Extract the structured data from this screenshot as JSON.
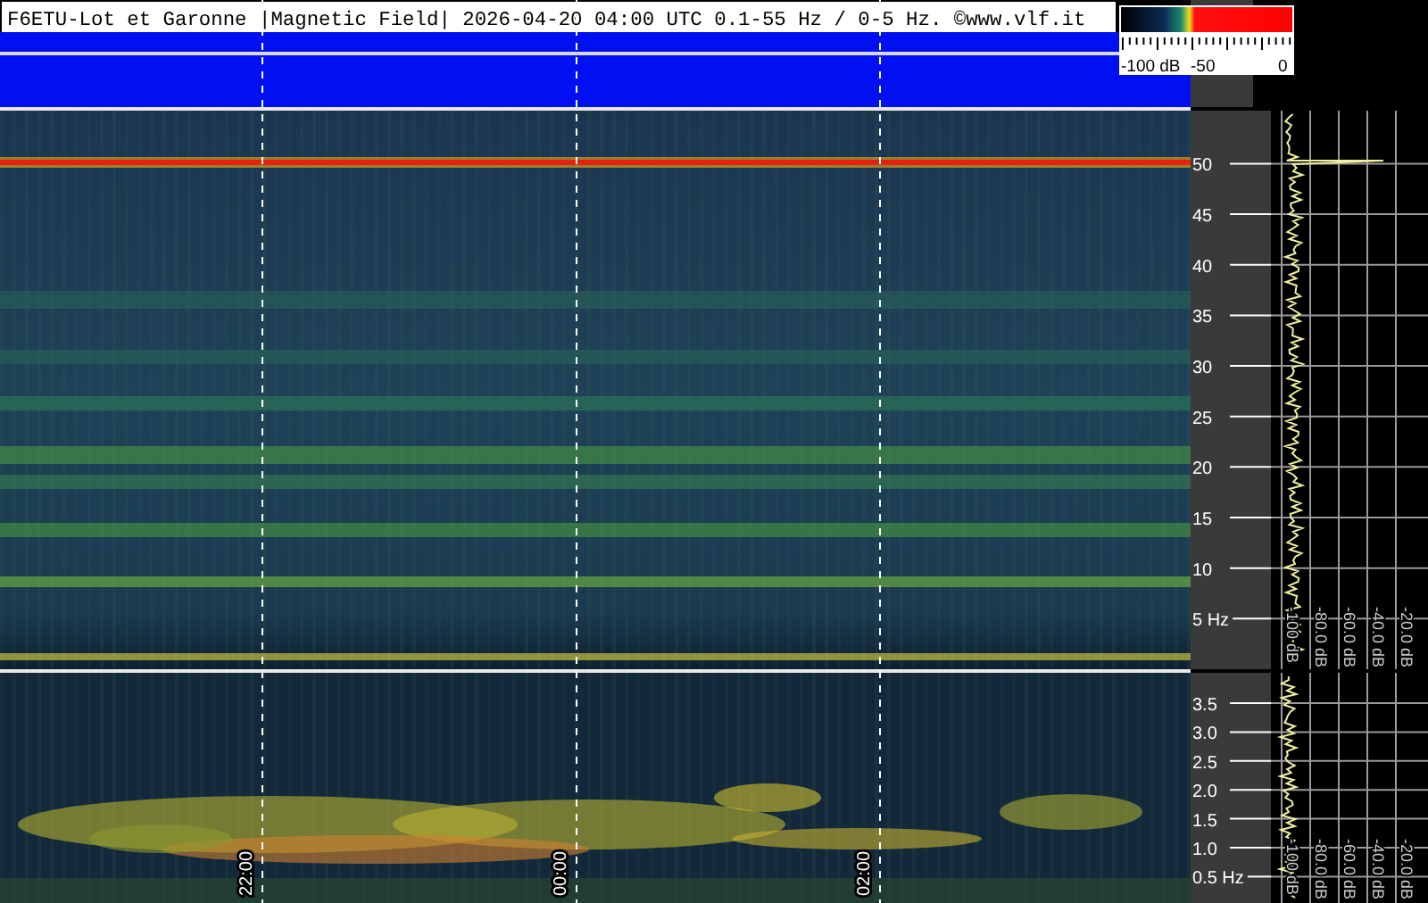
{
  "header": {
    "title": "F6ETU-Lot et Garonne |Magnetic Field| 2026-04-20 04:00 UTC 0.1-55 Hz / 0-5 Hz. ©www.vlf.it"
  },
  "color_scale": {
    "labels": [
      "-100 dB",
      "-50",
      "0"
    ]
  },
  "time_labels": [
    "22:00",
    "00:00",
    "02:00"
  ],
  "upper_panel": {
    "freq_labels": [
      "50",
      "45",
      "40",
      "35",
      "30",
      "25",
      "20",
      "15",
      "10",
      "5 Hz"
    ],
    "db_labels": [
      "-100 dB",
      "-80.0 dB",
      "-60.0 dB",
      "-40.0 dB",
      "-20.0 dB"
    ]
  },
  "lower_panel": {
    "freq_labels": [
      "3.5",
      "3.0",
      "2.5",
      "2.0",
      "1.5",
      "1.0",
      "0.5 Hz"
    ],
    "db_labels": [
      "-100 dB",
      "-80.0 dB",
      "-60.0 dB",
      "-40.0 dB",
      "-20.0 dB"
    ]
  }
}
